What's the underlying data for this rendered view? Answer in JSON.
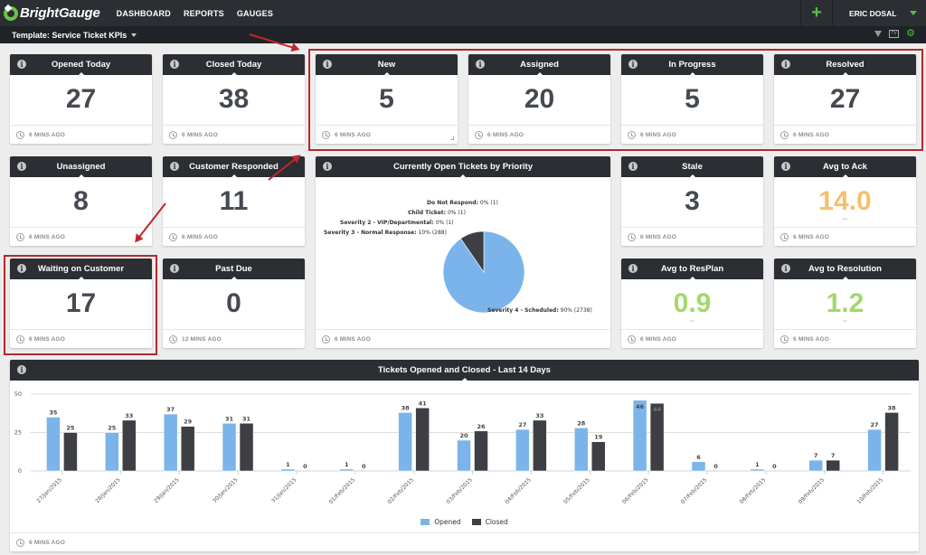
{
  "app": {
    "brand": "BrightGauge",
    "nav": [
      "DASHBOARD",
      "REPORTS",
      "GAUGES"
    ],
    "user": "ERIC DOSAL",
    "add_icon": "+",
    "template_label": "Template: Service Ticket KPIs",
    "toolbar_icons": [
      "filter-icon",
      "tv-icon",
      "gear-icon"
    ],
    "tv_text": "TV"
  },
  "colors": {
    "accent_green": "#4cc242",
    "header_dark": "#2b2e33",
    "value_dark": "#454950",
    "value_orange": "#f6c06b",
    "value_green": "#a3d86c",
    "opened": "#7ab4ea",
    "closed": "#3d3f44",
    "highlight_red": "#b3282d"
  },
  "gauges": [
    {
      "title": "Opened Today",
      "value": "27",
      "updated": "6 MINS AGO"
    },
    {
      "title": "Closed Today",
      "value": "38",
      "updated": "6 MINS AGO"
    },
    {
      "title": "New",
      "value": "5",
      "updated": "6 MINS AGO"
    },
    {
      "title": "Assigned",
      "value": "20",
      "updated": "6 MINS AGO"
    },
    {
      "title": "In Progress",
      "value": "5",
      "updated": "6 MINS AGO"
    },
    {
      "title": "Resolved",
      "value": "27",
      "updated": "6 MINS AGO"
    },
    {
      "title": "Unassigned",
      "value": "8",
      "updated": "6 MINS AGO"
    },
    {
      "title": "Customer Responded",
      "value": "11",
      "updated": "6 MINS AGO"
    },
    {
      "title": "Stale",
      "value": "3",
      "updated": "6 MINS AGO"
    },
    {
      "title": "Avg to Ack",
      "value": "14.0",
      "unit": "mins",
      "updated": "6 MINS AGO"
    },
    {
      "title": "Waiting on Customer",
      "value": "17",
      "updated": "6 MINS AGO"
    },
    {
      "title": "Past Due",
      "value": "0",
      "updated": "12 MINS AGO"
    },
    {
      "title": "Avg to ResPlan",
      "value": "0.9",
      "unit": "hrs",
      "updated": "6 MINS AGO"
    },
    {
      "title": "Avg to Resolution",
      "value": "1.2",
      "unit": "hrs",
      "updated": "6 MINS AGO"
    }
  ],
  "pie_card": {
    "title": "Currently Open Tickets by Priority",
    "updated": "6 MINS AGO"
  },
  "bar_card": {
    "title": "Tickets Opened and Closed - Last 14 Days",
    "updated": "6 MINS AGO"
  },
  "chart_data": [
    {
      "type": "pie",
      "title": "Currently Open Tickets by Priority",
      "slices": [
        {
          "label": "Severity 4 - Scheduled",
          "percent": "90%",
          "value": 2738
        },
        {
          "label": "Severity 3 - Normal Response",
          "percent": "10%",
          "value": 288
        },
        {
          "label": "Severity 2 - VIP/Departmental",
          "percent": "0%",
          "value": 1
        },
        {
          "label": "Child Ticket",
          "percent": "0%",
          "value": 1
        },
        {
          "label": "Do Not Respond",
          "percent": "0%",
          "value": 1
        }
      ]
    },
    {
      "type": "bar",
      "title": "Tickets Opened and Closed - Last 14 Days",
      "categories": [
        "27/Jan/2015",
        "28/Jan/2015",
        "29/Jan/2015",
        "30/Jan/2015",
        "31/Jan/2015",
        "01/Feb/2015",
        "02/Feb/2015",
        "03/Feb/2015",
        "04/Feb/2015",
        "05/Feb/2015",
        "06/Feb/2015",
        "07/Feb/2015",
        "08/Feb/2015",
        "09/Feb/2015",
        "10/Feb/2015"
      ],
      "series": [
        {
          "name": "Opened",
          "values": [
            35,
            25,
            37,
            31,
            1,
            1,
            38,
            20,
            27,
            28,
            46,
            6,
            1,
            7,
            27
          ]
        },
        {
          "name": "Closed",
          "values": [
            25,
            33,
            29,
            31,
            0,
            0,
            41,
            26,
            33,
            19,
            44,
            0,
            0,
            7,
            38
          ]
        }
      ],
      "yticks": [
        0,
        25,
        50
      ],
      "ylim": [
        0,
        50
      ],
      "grid": true,
      "legend": "bottom-center",
      "xlabel": "",
      "ylabel": ""
    }
  ],
  "annotations": {
    "highlight_boxes": [
      "new-to-resolved-row",
      "waiting-on-customer"
    ],
    "arrows": 3
  }
}
